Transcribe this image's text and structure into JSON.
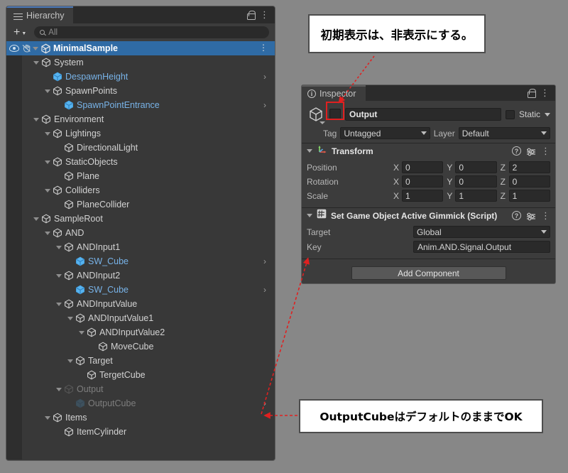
{
  "hierarchy": {
    "tab_label": "Hierarchy",
    "tab_icon": "hierarchy-icon",
    "lock_icon": "lock-icon",
    "menu_icon": "kebab-menu-icon",
    "add_label": "+",
    "search_placeholder": "All",
    "search_value": "",
    "rows": [
      {
        "label": "MinimalSample",
        "depth": 0,
        "expanded": true,
        "selected": true,
        "prefab": false,
        "dim": false,
        "chevron": false,
        "unity_icon": true,
        "eyehand": true,
        "kebab": true
      },
      {
        "label": "System",
        "depth": 1,
        "expanded": true,
        "selected": false,
        "prefab": false,
        "dim": false,
        "chevron": false
      },
      {
        "label": "DespawnHeight",
        "depth": 2,
        "expanded": false,
        "selected": false,
        "prefab": true,
        "dim": false,
        "chevron": true
      },
      {
        "label": "SpawnPoints",
        "depth": 2,
        "expanded": true,
        "selected": false,
        "prefab": false,
        "dim": false,
        "chevron": false
      },
      {
        "label": "SpawnPointEntrance",
        "depth": 3,
        "expanded": false,
        "selected": false,
        "prefab": true,
        "dim": false,
        "chevron": true
      },
      {
        "label": "Environment",
        "depth": 1,
        "expanded": true,
        "selected": false,
        "prefab": false,
        "dim": false,
        "chevron": false
      },
      {
        "label": "Lightings",
        "depth": 2,
        "expanded": true,
        "selected": false,
        "prefab": false,
        "dim": false,
        "chevron": false
      },
      {
        "label": "DirectionalLight",
        "depth": 3,
        "expanded": false,
        "selected": false,
        "prefab": false,
        "dim": false,
        "chevron": false
      },
      {
        "label": "StaticObjects",
        "depth": 2,
        "expanded": true,
        "selected": false,
        "prefab": false,
        "dim": false,
        "chevron": false
      },
      {
        "label": "Plane",
        "depth": 3,
        "expanded": false,
        "selected": false,
        "prefab": false,
        "dim": false,
        "chevron": false
      },
      {
        "label": "Colliders",
        "depth": 2,
        "expanded": true,
        "selected": false,
        "prefab": false,
        "dim": false,
        "chevron": false
      },
      {
        "label": "PlaneCollider",
        "depth": 3,
        "expanded": false,
        "selected": false,
        "prefab": false,
        "dim": false,
        "chevron": false
      },
      {
        "label": "SampleRoot",
        "depth": 1,
        "expanded": true,
        "selected": false,
        "prefab": false,
        "dim": false,
        "chevron": false
      },
      {
        "label": "AND",
        "depth": 2,
        "expanded": true,
        "selected": false,
        "prefab": false,
        "dim": false,
        "chevron": false
      },
      {
        "label": "ANDInput1",
        "depth": 3,
        "expanded": true,
        "selected": false,
        "prefab": false,
        "dim": false,
        "chevron": false
      },
      {
        "label": "SW_Cube",
        "depth": 4,
        "expanded": false,
        "selected": false,
        "prefab": true,
        "dim": false,
        "chevron": true
      },
      {
        "label": "ANDInput2",
        "depth": 3,
        "expanded": true,
        "selected": false,
        "prefab": false,
        "dim": false,
        "chevron": false
      },
      {
        "label": "SW_Cube",
        "depth": 4,
        "expanded": false,
        "selected": false,
        "prefab": true,
        "dim": false,
        "chevron": true
      },
      {
        "label": "ANDInputValue",
        "depth": 3,
        "expanded": true,
        "selected": false,
        "prefab": false,
        "dim": false,
        "chevron": false
      },
      {
        "label": "ANDInputValue1",
        "depth": 4,
        "expanded": true,
        "selected": false,
        "prefab": false,
        "dim": false,
        "chevron": false
      },
      {
        "label": "ANDInputValue2",
        "depth": 5,
        "expanded": true,
        "selected": false,
        "prefab": false,
        "dim": false,
        "chevron": false
      },
      {
        "label": "MoveCube",
        "depth": 6,
        "expanded": false,
        "selected": false,
        "prefab": false,
        "dim": false,
        "chevron": false
      },
      {
        "label": "Target",
        "depth": 4,
        "expanded": true,
        "selected": false,
        "prefab": false,
        "dim": false,
        "chevron": false
      },
      {
        "label": "TergetCube",
        "depth": 5,
        "expanded": false,
        "selected": false,
        "prefab": false,
        "dim": false,
        "chevron": false
      },
      {
        "label": "Output",
        "depth": 3,
        "expanded": true,
        "selected": false,
        "prefab": false,
        "dim": true,
        "chevron": false
      },
      {
        "label": "OutputCube",
        "depth": 4,
        "expanded": false,
        "selected": false,
        "prefab": true,
        "dim": true,
        "chevron": true
      },
      {
        "label": "Items",
        "depth": 2,
        "expanded": true,
        "selected": false,
        "prefab": false,
        "dim": false,
        "chevron": false
      },
      {
        "label": "ItemCylinder",
        "depth": 3,
        "expanded": false,
        "selected": false,
        "prefab": false,
        "dim": false,
        "chevron": false
      }
    ]
  },
  "inspector": {
    "tab_label": "Inspector",
    "tab_icon": "info-icon",
    "lock_icon": "lock-icon",
    "menu_icon": "kebab-menu-icon",
    "object_name": "Output",
    "active_checked": false,
    "static_label": "Static",
    "static_checked": false,
    "tag_label": "Tag",
    "tag_value": "Untagged",
    "layer_label": "Layer",
    "layer_value": "Default",
    "transform": {
      "title": "Transform",
      "rows": [
        {
          "label": "Position",
          "x": "0",
          "y": "0",
          "z": "2"
        },
        {
          "label": "Rotation",
          "x": "0",
          "y": "0",
          "z": "0"
        },
        {
          "label": "Scale",
          "x": "1",
          "y": "1",
          "z": "1"
        }
      ],
      "axis_x": "X",
      "axis_y": "Y",
      "axis_z": "Z"
    },
    "script": {
      "title": "Set Game Object Active Gimmick (Script)",
      "target_label": "Target",
      "target_value": "Global",
      "key_label": "Key",
      "key_value": "Anim.AND.Signal.Output"
    },
    "add_component_label": "Add Component"
  },
  "annotations": {
    "top_note": "初期表示は、非表示にする。",
    "bottom_note": "OutputCubeはデフォルトのままでOK",
    "arrow_color": "#e02020",
    "highlight_color": "#e02020"
  }
}
